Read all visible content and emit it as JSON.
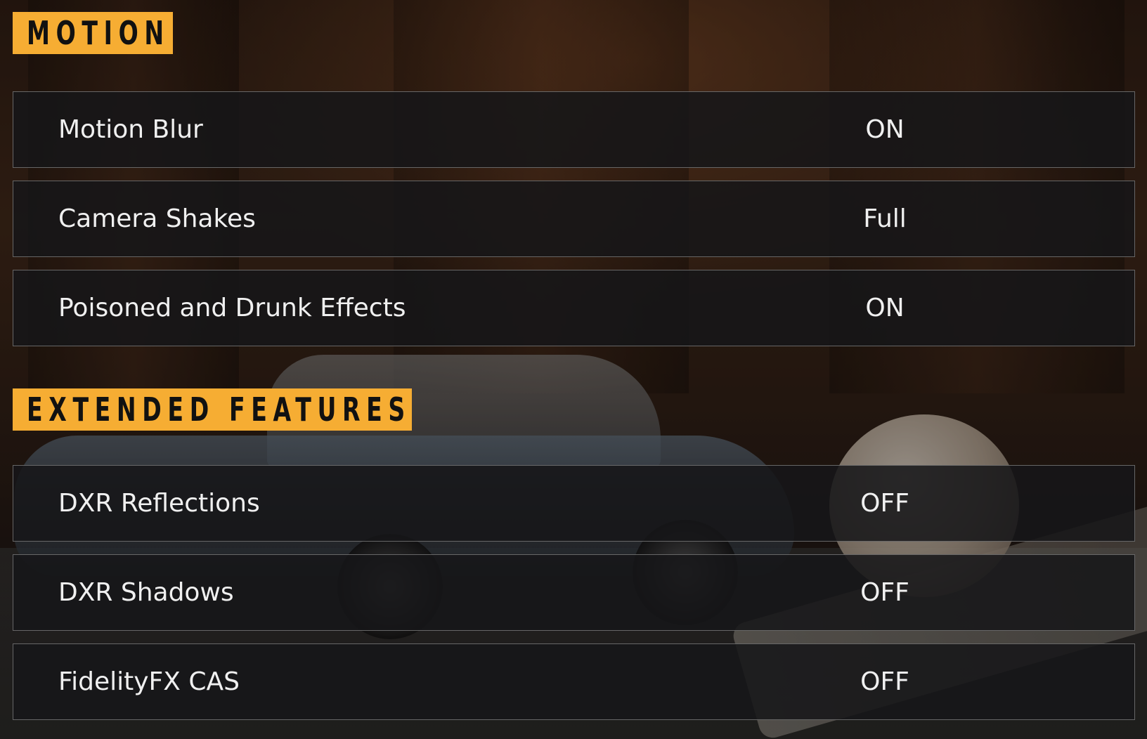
{
  "sections": {
    "motion": {
      "title": "MOTION",
      "settings": [
        {
          "label": "Motion Blur",
          "value": "ON"
        },
        {
          "label": "Camera Shakes",
          "value": "Full"
        },
        {
          "label": "Poisoned and Drunk Effects",
          "value": "ON"
        }
      ]
    },
    "extended_features": {
      "title": "EXTENDED FEATURES",
      "settings": [
        {
          "label": "DXR Reflections",
          "value": "OFF"
        },
        {
          "label": "DXR Shadows",
          "value": "OFF"
        },
        {
          "label": "FidelityFX CAS",
          "value": "OFF"
        }
      ]
    }
  },
  "colors": {
    "header_accent": "#f6ad33",
    "row_background": "#161618",
    "row_border": "#828282",
    "text": "#f0f0f0"
  }
}
